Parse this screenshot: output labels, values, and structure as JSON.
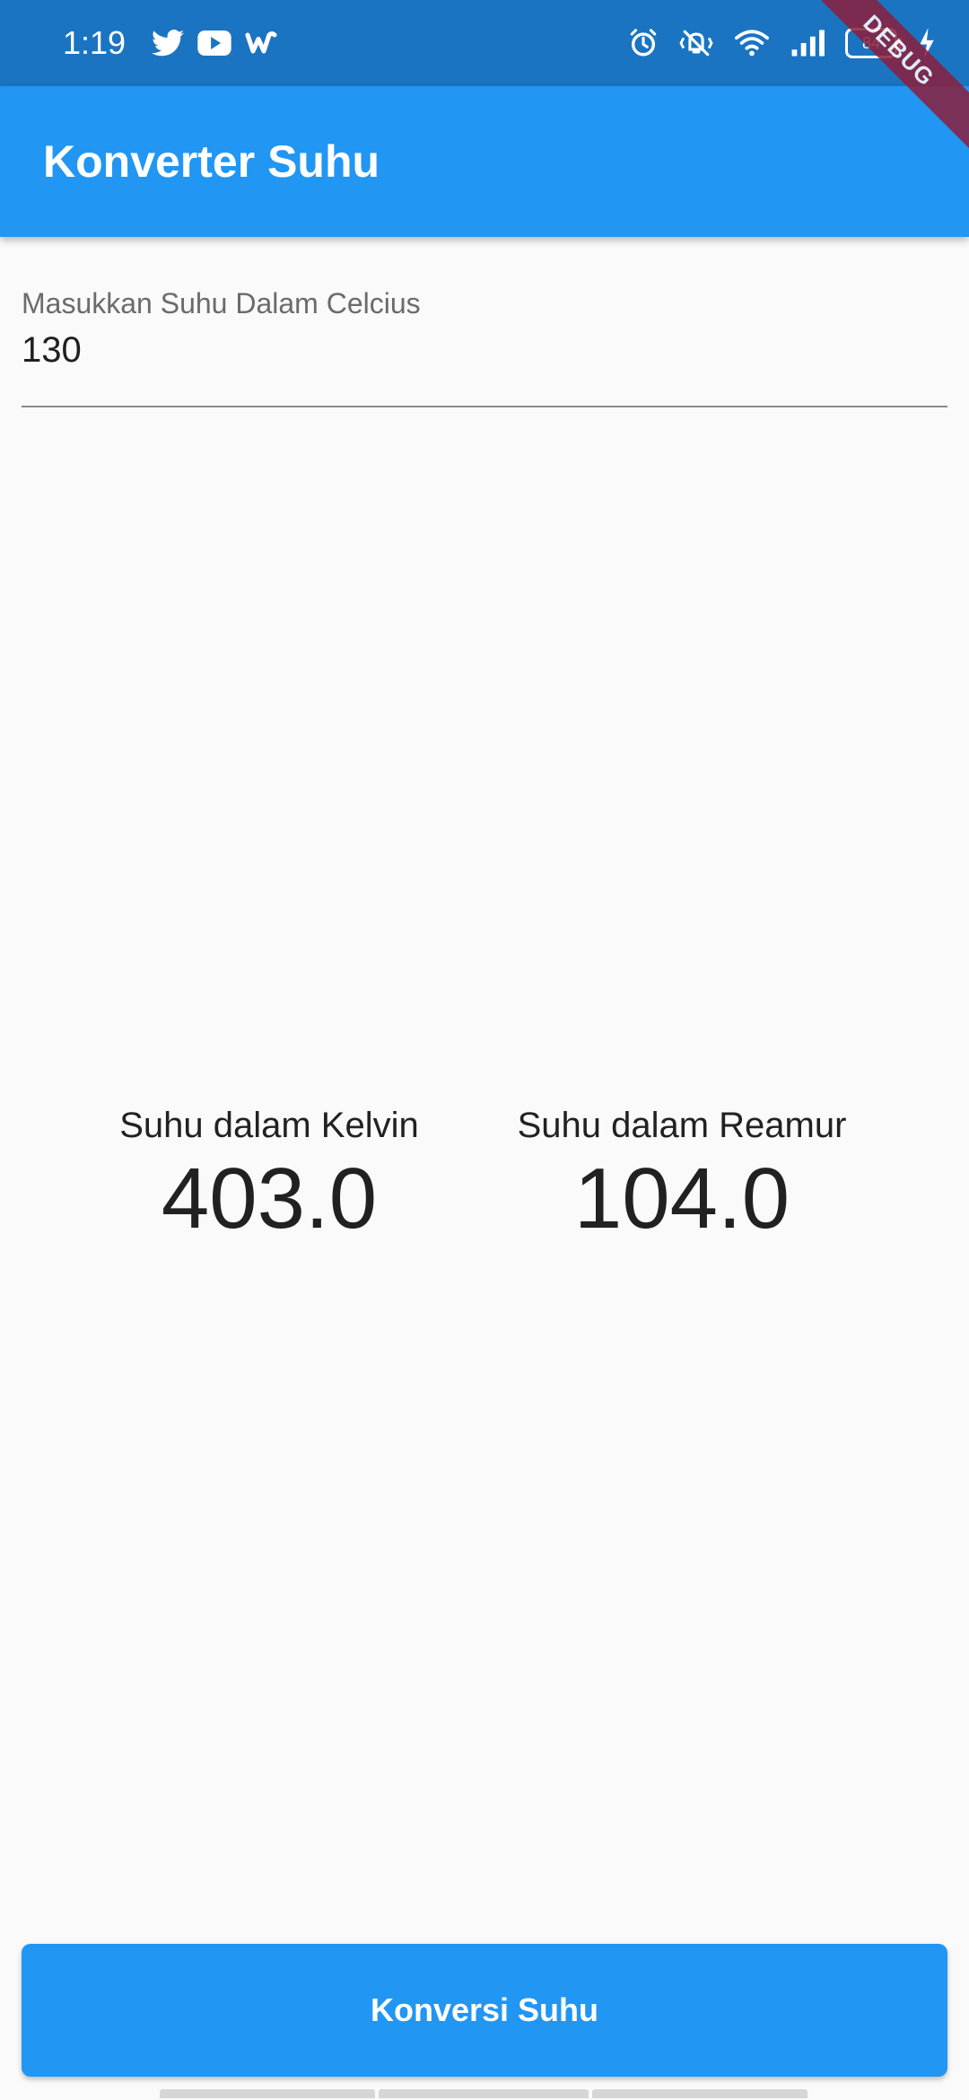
{
  "status_bar": {
    "time": "1:19",
    "battery_level": "84",
    "left_icons": [
      "twitter-icon",
      "youtube-icon",
      "wattpad-icon"
    ],
    "right_icons": [
      "alarm-icon",
      "vibrate-icon",
      "wifi-icon",
      "signal-icon",
      "battery-icon",
      "charging-icon"
    ],
    "color": "#1a74c2"
  },
  "debug_banner": "DEBUG",
  "app_bar": {
    "title": "Konverter Suhu",
    "color": "#2196f3"
  },
  "celsius_input": {
    "label": "Masukkan Suhu Dalam Celcius",
    "value": "130"
  },
  "results": {
    "kelvin": {
      "label": "Suhu dalam Kelvin",
      "value": "403.0"
    },
    "reamur": {
      "label": "Suhu dalam Reamur",
      "value": "104.0"
    }
  },
  "convert_button": {
    "label": "Konversi Suhu",
    "color": "#2196f3"
  }
}
